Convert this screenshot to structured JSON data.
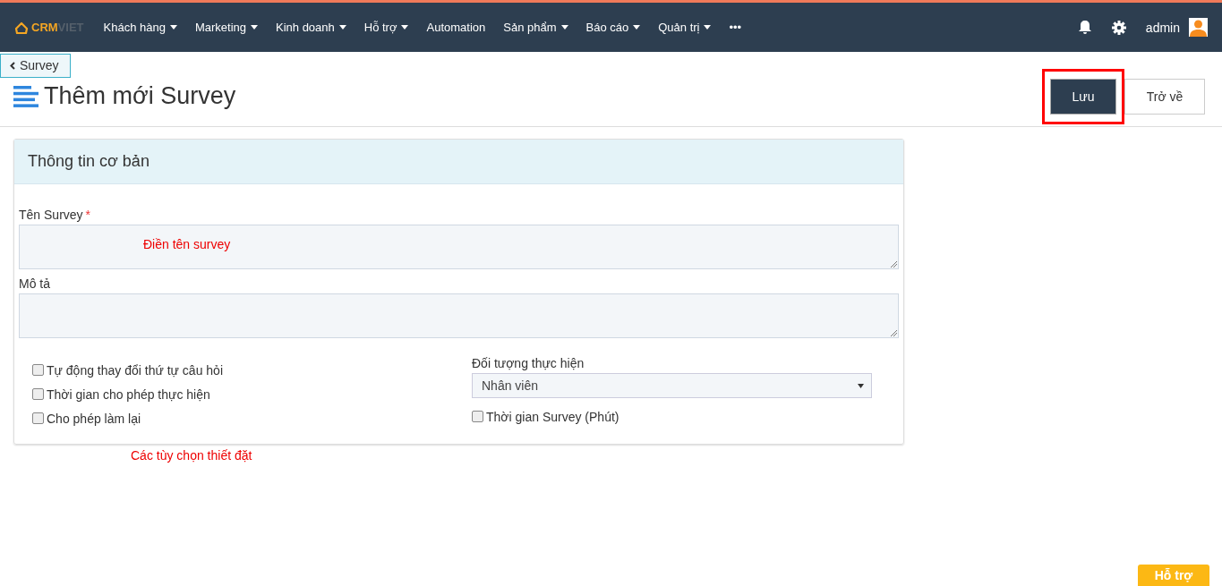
{
  "logo": {
    "part_1": "CRM",
    "part_2": "VIET"
  },
  "nav": [
    {
      "label": "Khách hàng",
      "dropdown": true
    },
    {
      "label": "Marketing",
      "dropdown": true
    },
    {
      "label": "Kinh doanh",
      "dropdown": true
    },
    {
      "label": "Hỗ trợ",
      "dropdown": true
    },
    {
      "label": "Automation",
      "dropdown": false
    },
    {
      "label": "Sản phẩm",
      "dropdown": true
    },
    {
      "label": "Báo cáo",
      "dropdown": true
    },
    {
      "label": "Quản trị",
      "dropdown": true
    },
    {
      "label": "•••",
      "dropdown": false
    }
  ],
  "user": {
    "name": "admin"
  },
  "back_link": "Survey",
  "page_title": "Thêm mới Survey",
  "buttons": [
    {
      "label": "Lưu",
      "kind": "primary",
      "highlighted": true
    },
    {
      "label": "Trở về",
      "kind": "default",
      "highlighted": false
    }
  ],
  "panel": {
    "title": "Thông tin cơ bản",
    "fields": [
      {
        "label": "Tên Survey",
        "required_mark": "*",
        "annotation": "Điền tên survey"
      },
      {
        "label": "Mô tả"
      }
    ],
    "options_left": [
      {
        "label": "Tự động thay đổi thứ tự câu hỏi",
        "checked": false
      },
      {
        "label": "Thời gian cho phép thực hiện",
        "checked": false
      },
      {
        "label": "Cho phép làm lại",
        "checked": false
      }
    ],
    "target": {
      "label": "Đối tượng thực hiện",
      "value": "Nhân viên"
    },
    "options_right": [
      {
        "label": "Thời gian Survey (Phút)",
        "checked": false
      }
    ]
  },
  "annotation_below": "Các tùy chọn thiết đặt",
  "help_button": "Hỗ trợ"
}
